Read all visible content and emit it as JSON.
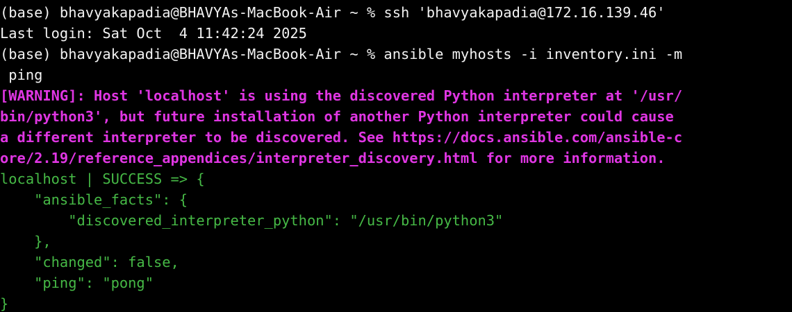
{
  "colors": {
    "background": "#000000",
    "text": "#f2f2f2",
    "warning": "#e036e3",
    "success": "#46b946"
  },
  "terminal": {
    "lines": [
      {
        "text": "(base) bhavyakapadia@BHAVYAs-MacBook-Air ~ % ssh 'bhavyakapadia@172.16.139.46'",
        "kind": "prompt"
      },
      {
        "text": "Last login: Sat Oct  4 11:42:24 2025",
        "kind": "output"
      },
      {
        "text": "(base) bhavyakapadia@BHAVYAs-MacBook-Air ~ % ansible myhosts -i inventory.ini -m",
        "kind": "prompt"
      },
      {
        "text": " ping",
        "kind": "prompt"
      },
      {
        "text": "[WARNING]: Host 'localhost' is using the discovered Python interpreter at '/usr/",
        "kind": "warning"
      },
      {
        "text": "bin/python3', but future installation of another Python interpreter could cause",
        "kind": "warning"
      },
      {
        "text": "a different interpreter to be discovered. See https://docs.ansible.com/ansible-c",
        "kind": "warning"
      },
      {
        "text": "ore/2.19/reference_appendices/interpreter_discovery.html for more information.",
        "kind": "warning"
      },
      {
        "text": "localhost | SUCCESS => {",
        "kind": "success"
      },
      {
        "text": "    \"ansible_facts\": {",
        "kind": "success"
      },
      {
        "text": "        \"discovered_interpreter_python\": \"/usr/bin/python3\"",
        "kind": "success"
      },
      {
        "text": "    },",
        "kind": "success"
      },
      {
        "text": "    \"changed\": false,",
        "kind": "success"
      },
      {
        "text": "    \"ping\": \"pong\"",
        "kind": "success"
      },
      {
        "text": "}",
        "kind": "success"
      }
    ]
  }
}
